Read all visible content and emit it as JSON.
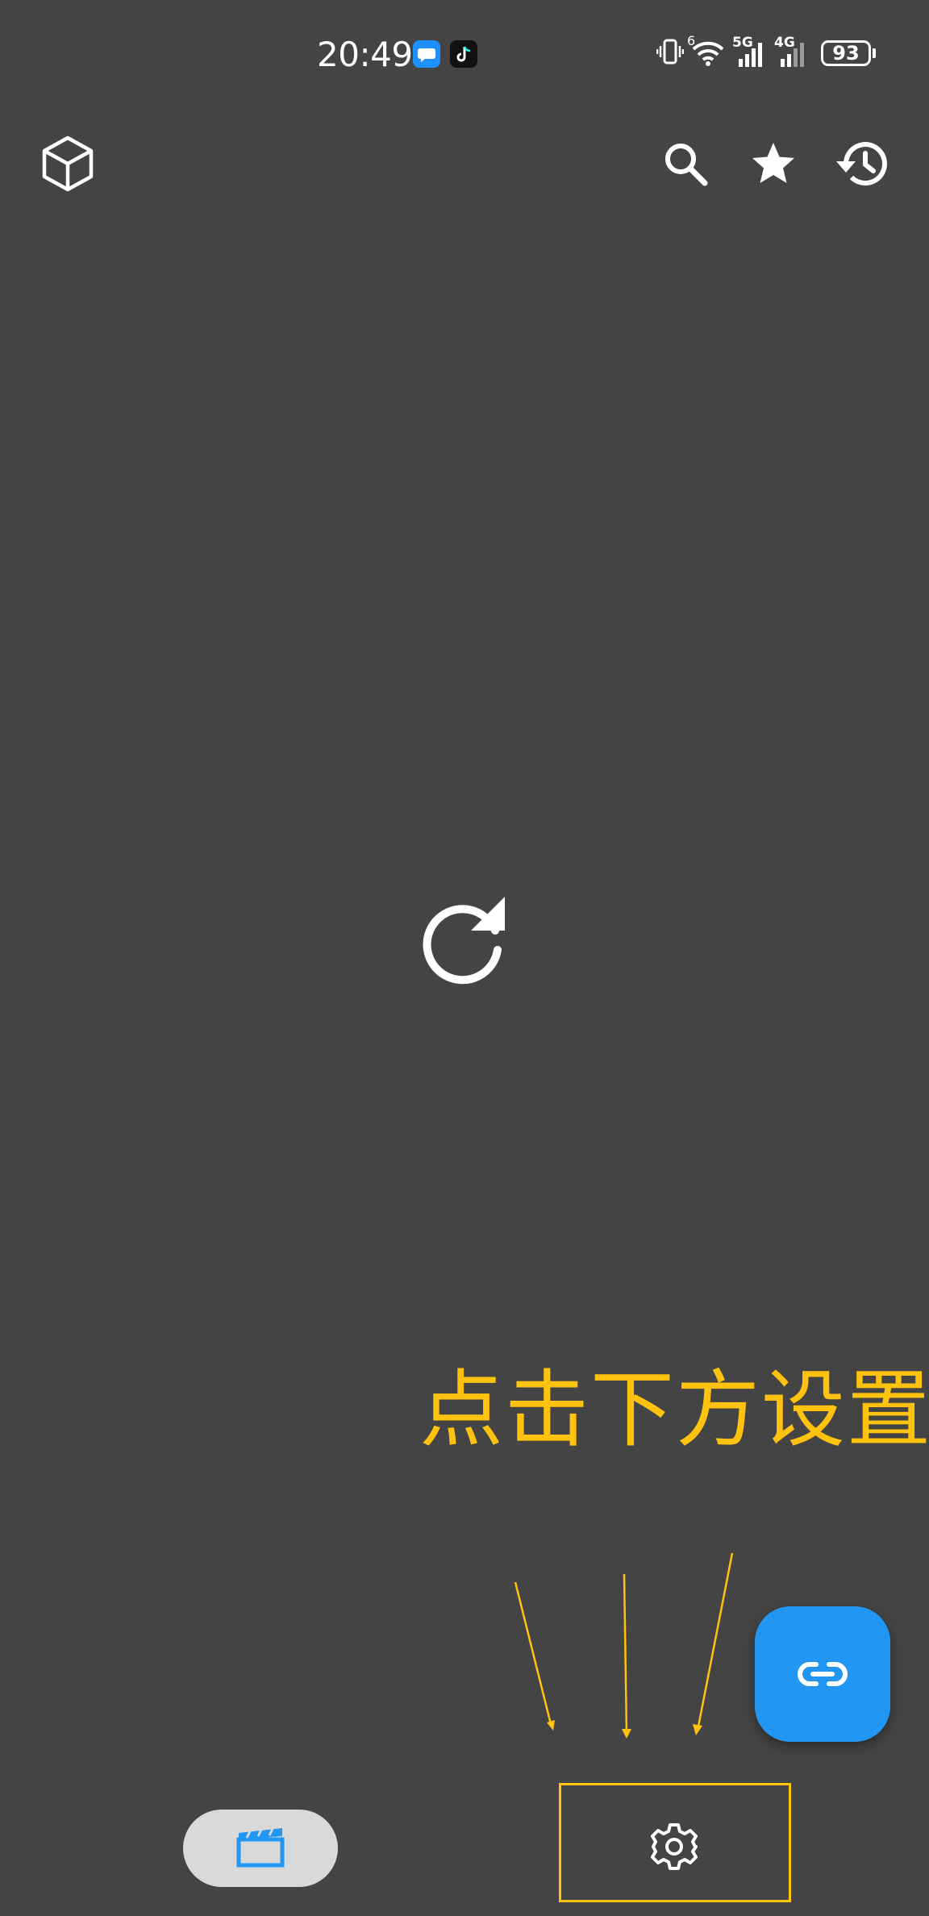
{
  "status_bar": {
    "time": "20:49",
    "notification_icons": [
      "message-bubble-icon",
      "tiktok-icon"
    ],
    "signal_labels": [
      "6",
      "5G",
      "4G"
    ],
    "battery": "93"
  },
  "top_bar": {
    "logo_icon": "cube-icon",
    "actions": [
      "search-icon",
      "star-icon",
      "history-icon"
    ]
  },
  "main": {
    "loading_icon": "refresh-icon"
  },
  "annotation": {
    "text": "点击下方设置",
    "color": "#FFC20E"
  },
  "fab": {
    "icon": "link-icon",
    "color": "#2196F3"
  },
  "bottom_nav": {
    "items": [
      {
        "icon": "movie-clapperboard-icon",
        "selected": true
      },
      {
        "icon": "settings-gear-icon",
        "selected": false
      }
    ]
  }
}
